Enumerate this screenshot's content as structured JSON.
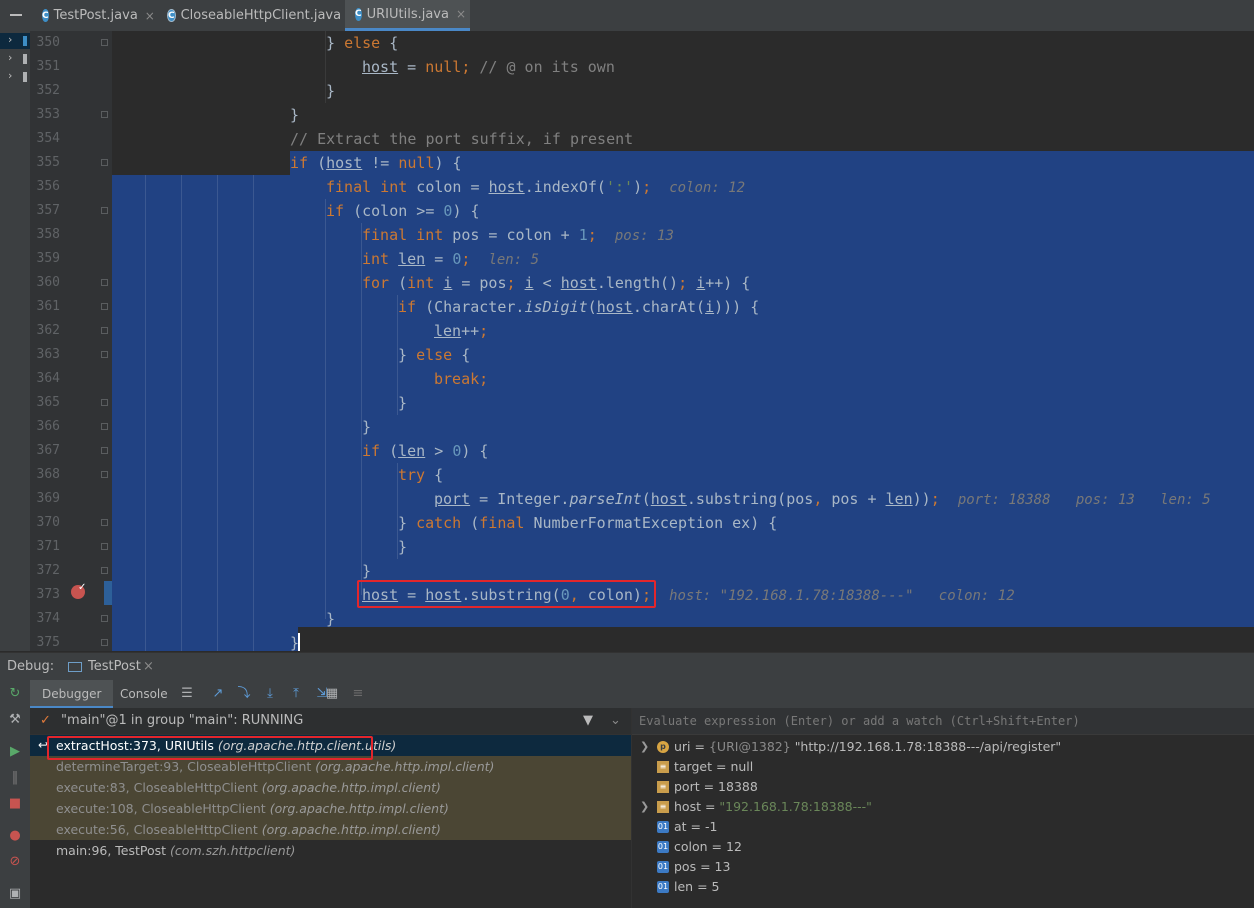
{
  "tabs": [
    {
      "label": "TestPost.java",
      "close": "×",
      "icon": "C"
    },
    {
      "label": "CloseableHttpClient.java",
      "close": "",
      "icon": "C"
    },
    {
      "label": "URIUtils.java",
      "close": "×",
      "icon": "C"
    }
  ],
  "editor": {
    "line_numbers": [
      "350",
      "351",
      "352",
      "353",
      "354",
      "355",
      "356",
      "357",
      "358",
      "359",
      "360",
      "361",
      "362",
      "363",
      "364",
      "365",
      "366",
      "367",
      "368",
      "369",
      "370",
      "371",
      "372",
      "373",
      "374",
      "375"
    ]
  },
  "debug": {
    "label": "Debug:",
    "run_config": "TestPost",
    "run_close": "×",
    "tabs": [
      "Debugger",
      "Console"
    ],
    "thread": "\"main\"@1 in group \"main\": RUNNING",
    "frames": [
      {
        "method": "extractHost:373, URIUtils",
        "pkg": "(org.apache.http.client.utils)",
        "state": "selected"
      },
      {
        "method": "determineTarget:93, CloseableHttpClient",
        "pkg": "(org.apache.http.impl.client)",
        "state": "library"
      },
      {
        "method": "execute:83, CloseableHttpClient",
        "pkg": "(org.apache.http.impl.client)",
        "state": "library"
      },
      {
        "method": "execute:108, CloseableHttpClient",
        "pkg": "(org.apache.http.impl.client)",
        "state": "library"
      },
      {
        "method": "execute:56, CloseableHttpClient",
        "pkg": "(org.apache.http.impl.client)",
        "state": "library"
      },
      {
        "method": "main:96, TestPost",
        "pkg": "(com.szh.httpclient)",
        "state": "normal"
      }
    ],
    "eval_placeholder": "Evaluate expression (Enter) or add a watch (Ctrl+Shift+Enter)",
    "variables": [
      {
        "name": "uri",
        "eq": " = ",
        "type": "{URI@1382} ",
        "value": "\"http://192.168.1.78:18388---/api/register\"",
        "icon": "p",
        "expand": true,
        "str": false
      },
      {
        "name": "target",
        "eq": " = ",
        "type": "",
        "value": "null",
        "icon": "f",
        "expand": false,
        "str": false
      },
      {
        "name": "port",
        "eq": " = ",
        "type": "",
        "value": "18388",
        "icon": "f",
        "expand": false,
        "str": false
      },
      {
        "name": "host",
        "eq": " = ",
        "type": "",
        "value": "\"192.168.1.78:18388---\"",
        "icon": "f",
        "expand": true,
        "str": true
      },
      {
        "name": "at",
        "eq": " = ",
        "type": "",
        "value": "-1",
        "icon": "o",
        "expand": false,
        "str": false
      },
      {
        "name": "colon",
        "eq": " = ",
        "type": "",
        "value": "12",
        "icon": "o",
        "expand": false,
        "str": false
      },
      {
        "name": "pos",
        "eq": " = ",
        "type": "",
        "value": "13",
        "icon": "o",
        "expand": false,
        "str": false
      },
      {
        "name": "len",
        "eq": " = ",
        "type": "",
        "value": "5",
        "icon": "o",
        "expand": false,
        "str": false
      }
    ]
  },
  "colors": {
    "selection": "#214283",
    "breakpoint": "#c75450",
    "highlight_box": "#e3262b"
  }
}
